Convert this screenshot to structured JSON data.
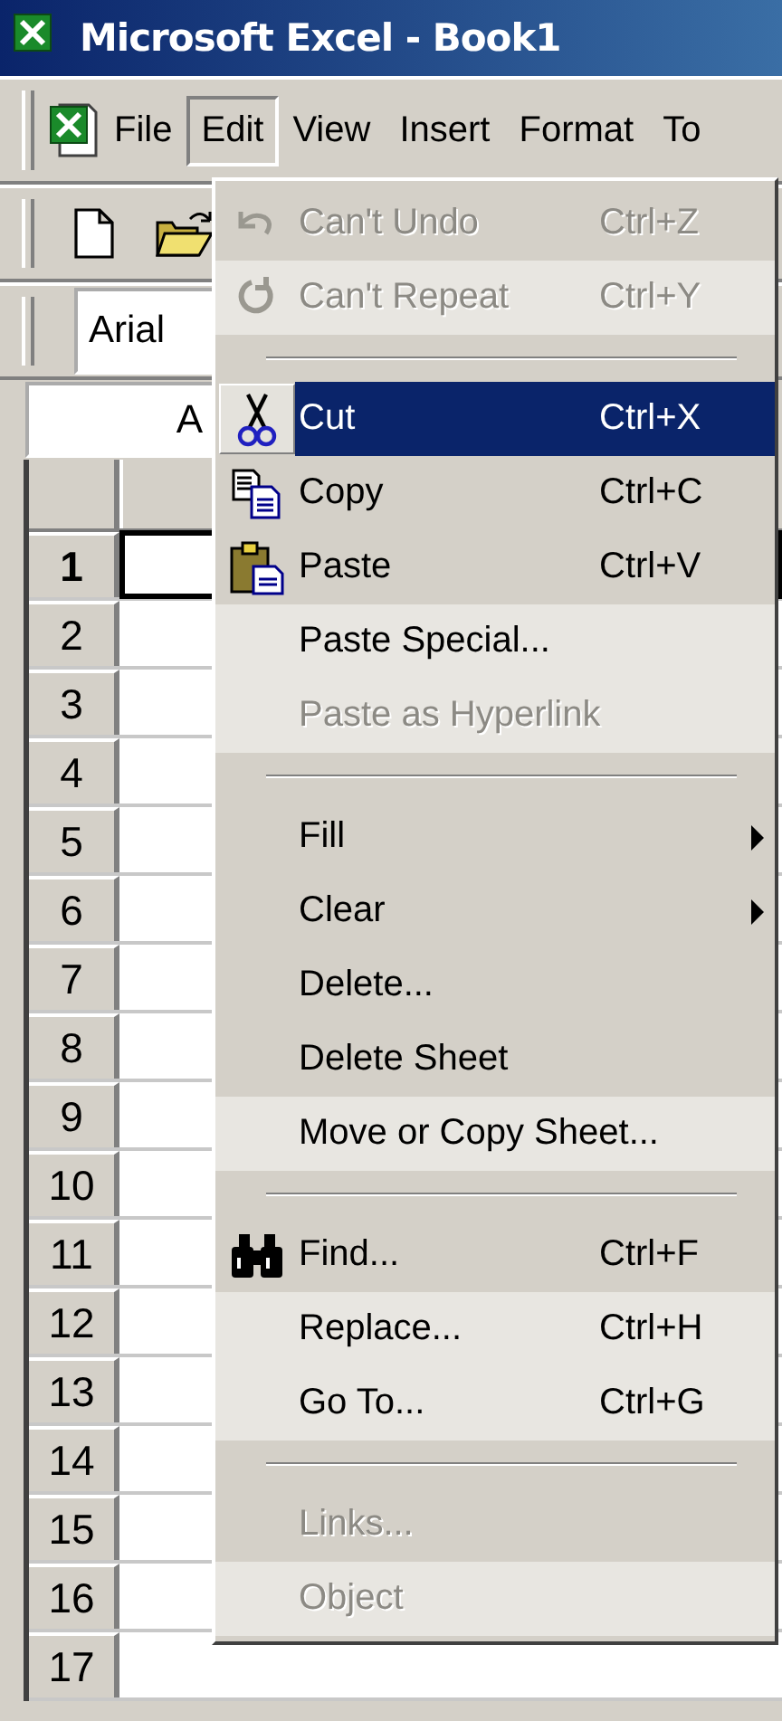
{
  "window": {
    "title": "Microsoft Excel - Book1"
  },
  "menu_bar": [
    {
      "label": "File",
      "selected": false
    },
    {
      "label": "Edit",
      "selected": true
    },
    {
      "label": "View",
      "selected": false
    },
    {
      "label": "Insert",
      "selected": false
    },
    {
      "label": "Format",
      "selected": false
    },
    {
      "label": "To",
      "selected": false
    }
  ],
  "font_box": {
    "value": "Arial"
  },
  "name_box": {
    "value": "A"
  },
  "row_headers": [
    {
      "label": "1",
      "selected": true
    },
    {
      "label": "2",
      "selected": false
    },
    {
      "label": "3",
      "selected": false
    },
    {
      "label": "4",
      "selected": false
    },
    {
      "label": "5",
      "selected": false
    },
    {
      "label": "6",
      "selected": false
    },
    {
      "label": "7",
      "selected": false
    },
    {
      "label": "8",
      "selected": false
    },
    {
      "label": "9",
      "selected": false
    },
    {
      "label": "10",
      "selected": false
    },
    {
      "label": "11",
      "selected": false
    },
    {
      "label": "12",
      "selected": false
    },
    {
      "label": "13",
      "selected": false
    },
    {
      "label": "14",
      "selected": false
    },
    {
      "label": "15",
      "selected": false
    },
    {
      "label": "16",
      "selected": false
    },
    {
      "label": "17",
      "selected": false
    }
  ],
  "edit_menu": [
    {
      "kind": "undo",
      "label": "Can't Undo",
      "shortcut": "Ctrl+Z",
      "disabled": true,
      "selected": false,
      "rarely_used": false,
      "submenu": false
    },
    {
      "kind": "redo",
      "label": "Can't Repeat",
      "shortcut": "Ctrl+Y",
      "disabled": true,
      "selected": false,
      "rarely_used": true,
      "submenu": false
    },
    {
      "kind": "separator"
    },
    {
      "kind": "cut",
      "label": "Cut",
      "shortcut": "Ctrl+X",
      "disabled": false,
      "selected": true,
      "rarely_used": false,
      "submenu": false
    },
    {
      "kind": "copy",
      "label": "Copy",
      "shortcut": "Ctrl+C",
      "disabled": false,
      "selected": false,
      "rarely_used": false,
      "submenu": false
    },
    {
      "kind": "paste",
      "label": "Paste",
      "shortcut": "Ctrl+V",
      "disabled": false,
      "selected": false,
      "rarely_used": false,
      "submenu": false
    },
    {
      "kind": "item",
      "label": "Paste Special...",
      "disabled": false,
      "selected": false,
      "rarely_used": true,
      "submenu": false
    },
    {
      "kind": "item",
      "label": "Paste as Hyperlink",
      "disabled": true,
      "selected": false,
      "rarely_used": true,
      "submenu": false
    },
    {
      "kind": "separator"
    },
    {
      "kind": "item",
      "label": "Fill",
      "disabled": false,
      "selected": false,
      "rarely_used": false,
      "submenu": true
    },
    {
      "kind": "item",
      "label": "Clear",
      "disabled": false,
      "selected": false,
      "rarely_used": false,
      "submenu": true
    },
    {
      "kind": "item",
      "label": "Delete...",
      "disabled": false,
      "selected": false,
      "rarely_used": false,
      "submenu": false
    },
    {
      "kind": "item",
      "label": "Delete Sheet",
      "disabled": false,
      "selected": false,
      "rarely_used": false,
      "submenu": false
    },
    {
      "kind": "item",
      "label": "Move or Copy Sheet...",
      "disabled": false,
      "selected": false,
      "rarely_used": true,
      "submenu": false
    },
    {
      "kind": "separator"
    },
    {
      "kind": "find",
      "label": "Find...",
      "shortcut": "Ctrl+F",
      "disabled": false,
      "selected": false,
      "rarely_used": false,
      "submenu": false
    },
    {
      "kind": "item",
      "label": "Replace...",
      "shortcut": "Ctrl+H",
      "disabled": false,
      "selected": false,
      "rarely_used": true,
      "submenu": false
    },
    {
      "kind": "item",
      "label": "Go To...",
      "shortcut": "Ctrl+G",
      "disabled": false,
      "selected": false,
      "rarely_used": true,
      "submenu": false
    },
    {
      "kind": "separator"
    },
    {
      "kind": "item",
      "label": "Links...",
      "disabled": true,
      "selected": false,
      "rarely_used": false,
      "submenu": false
    },
    {
      "kind": "item",
      "label": "Object",
      "disabled": true,
      "selected": false,
      "rarely_used": true,
      "submenu": false
    }
  ]
}
